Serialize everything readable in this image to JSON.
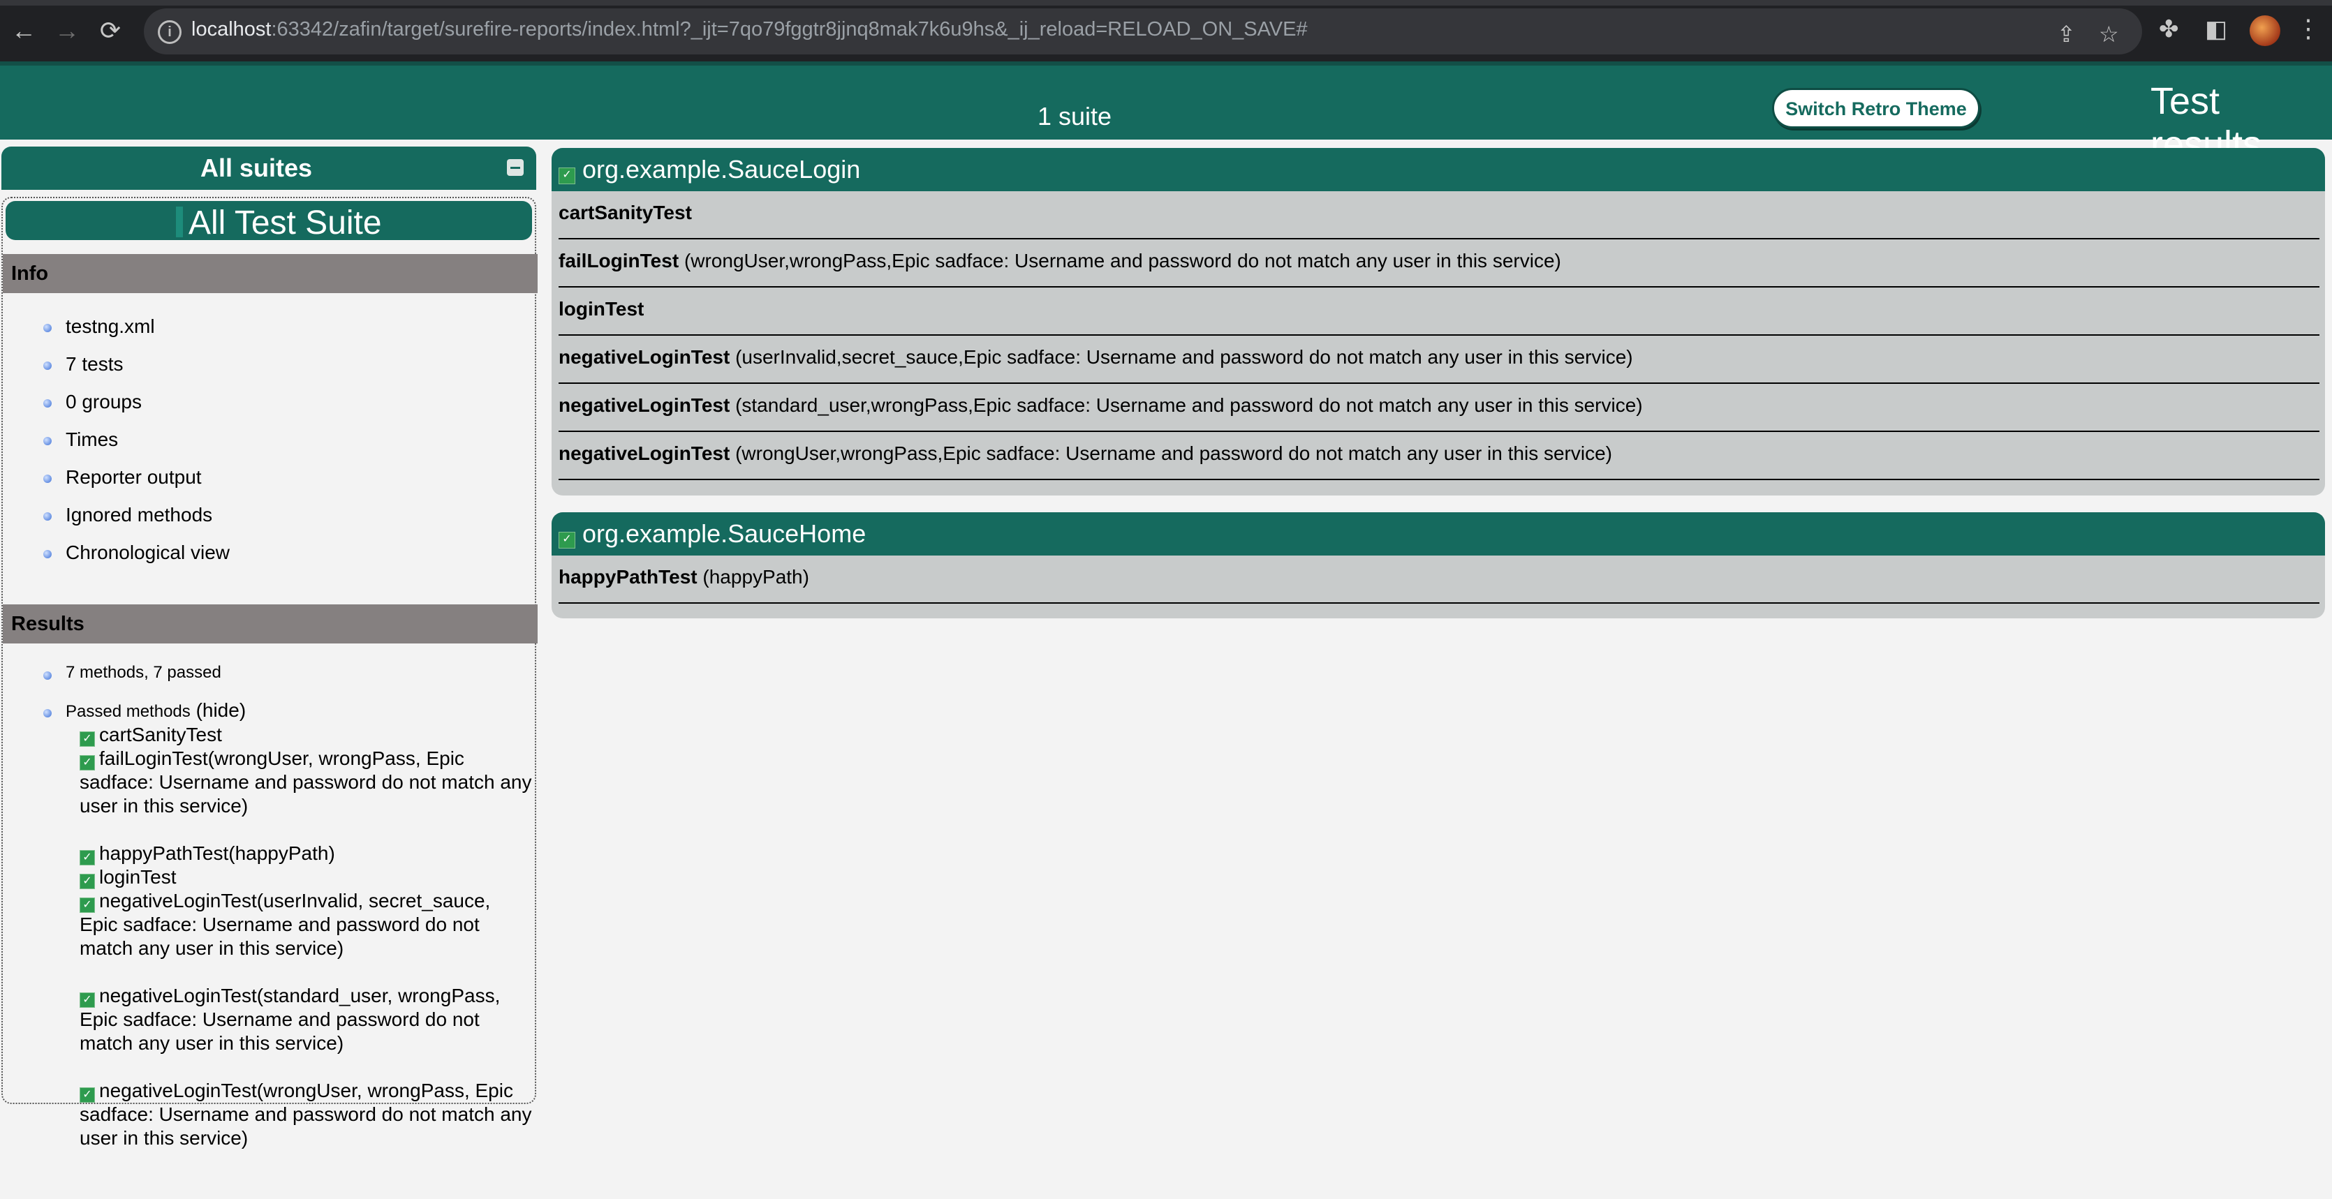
{
  "browser": {
    "url_host": "localhost",
    "url_rest": ":63342/zafin/target/surefire-reports/index.html?_ijt=7qo79fggtr8jjnq8mak7k6u9hs&_ij_reload=RELOAD_ON_SAVE#"
  },
  "header": {
    "suite_count": "1 suite",
    "retro_button": "Switch Retro Theme",
    "title": "Test results"
  },
  "navigator": {
    "all_suites": "All suites",
    "suite_name": "All Test Suite",
    "info_title": "Info",
    "info_items": [
      "testng.xml",
      "7 tests",
      "0 groups",
      "Times",
      "Reporter output",
      "Ignored methods",
      "Chronological view"
    ],
    "results_title": "Results",
    "summary": "7 methods, 7 passed",
    "passed_label": "Passed methods",
    "hide_label": "(hide)",
    "passed_methods": [
      "cartSanityTest",
      "failLoginTest(wrongUser, wrongPass, Epic sadface: Username and password do not match any user in this service)",
      "happyPathTest(happyPath)",
      "loginTest",
      "negativeLoginTest(userInvalid, secret_sauce, Epic sadface: Username and password do not match any user in this service)",
      "negativeLoginTest(standard_user, wrongPass, Epic sadface: Username and password do not match any user in this service)",
      "negativeLoginTest(wrongUser, wrongPass, Epic sadface: Username and password do not match any user in this service)"
    ]
  },
  "classes": [
    {
      "name": "org.example.SauceLogin",
      "tests": [
        {
          "name": "cartSanityTest",
          "params": ""
        },
        {
          "name": "failLoginTest",
          "params": "(wrongUser,wrongPass,Epic sadface: Username and password do not match any user in this service)"
        },
        {
          "name": "loginTest",
          "params": ""
        },
        {
          "name": "negativeLoginTest",
          "params": "(userInvalid,secret_sauce,Epic sadface: Username and password do not match any user in this service)"
        },
        {
          "name": "negativeLoginTest",
          "params": "(standard_user,wrongPass,Epic sadface: Username and password do not match any user in this service)"
        },
        {
          "name": "negativeLoginTest",
          "params": "(wrongUser,wrongPass,Epic sadface: Username and password do not match any user in this service)"
        }
      ]
    },
    {
      "name": "org.example.SauceHome",
      "tests": [
        {
          "name": "happyPathTest",
          "params": "(happyPath)"
        }
      ]
    }
  ],
  "colors": {
    "header_bg": "#156a5e",
    "section_bg": "#858080",
    "panel_bg": "#c8cbcb",
    "pass_check": "#2e9b4e"
  }
}
